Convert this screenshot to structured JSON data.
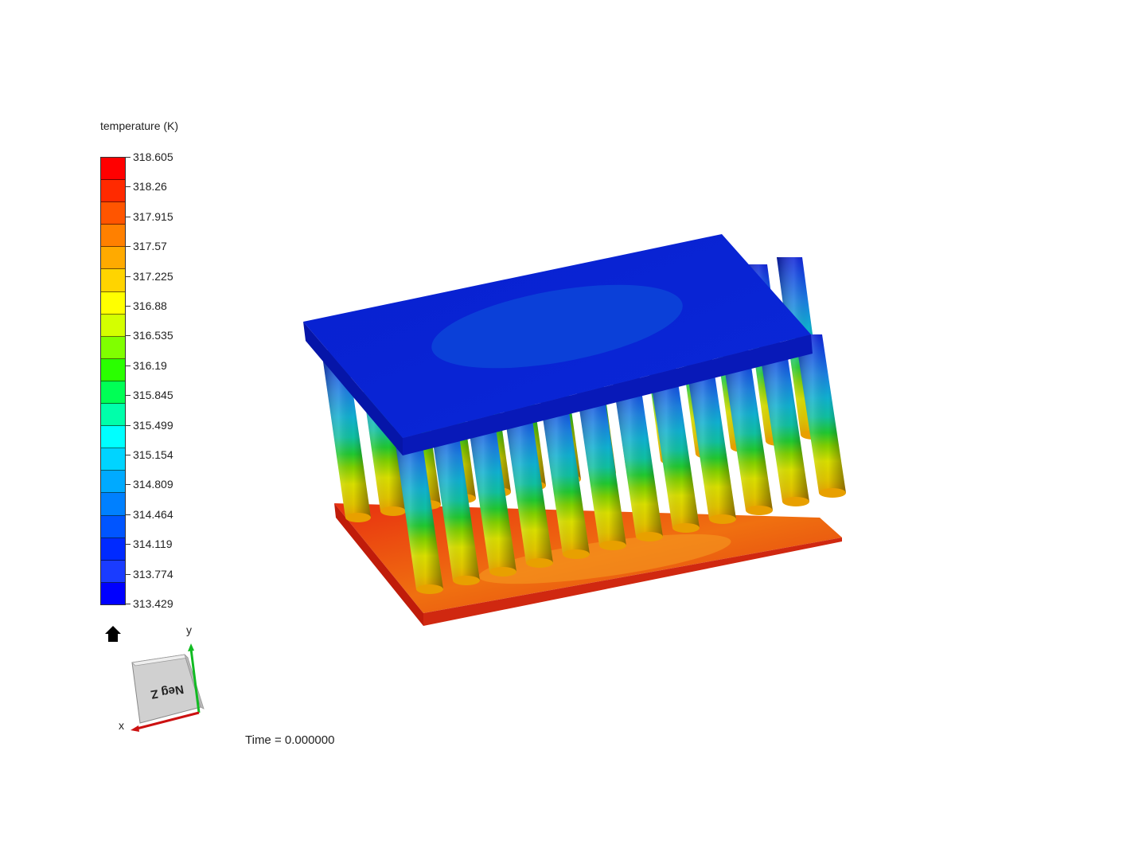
{
  "legend": {
    "title": "temperature (K)",
    "ticks": [
      "318.605",
      "318.26",
      "317.915",
      "317.57",
      "317.225",
      "316.88",
      "316.535",
      "316.19",
      "315.845",
      "315.499",
      "315.154",
      "314.809",
      "314.464",
      "314.119",
      "313.774",
      "313.429"
    ],
    "band_colors": [
      "#ff0000",
      "#ff2a00",
      "#ff5500",
      "#ff8000",
      "#ffaa00",
      "#ffd400",
      "#ffff00",
      "#d4ff00",
      "#80ff00",
      "#2aff00",
      "#00ff55",
      "#00ffaa",
      "#00ffff",
      "#00d4ff",
      "#00aaff",
      "#0080ff",
      "#0055ff",
      "#002aff",
      "#1a3cff",
      "#0000ff"
    ]
  },
  "orientation": {
    "cube_label": "Neg Z",
    "x_axis_label": "x",
    "y_axis_label": "y",
    "x_axis_color": "#cc1111",
    "y_axis_color": "#11bb22"
  },
  "time": {
    "label": "Time = 0.000000"
  },
  "icons": {
    "home": "home-icon"
  },
  "model": {
    "description_colors": {
      "hot": "#e02010",
      "cold": "#0a1fd6"
    }
  }
}
